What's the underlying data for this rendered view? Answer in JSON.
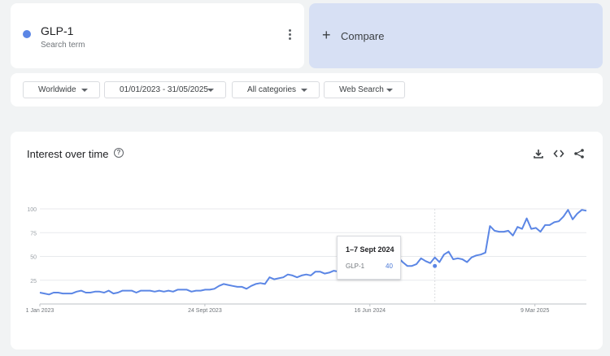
{
  "search_term": {
    "name": "GLP-1",
    "subtitle": "Search term",
    "color": "#5b86e5"
  },
  "compare": {
    "label": "Compare"
  },
  "filters": {
    "region": "Worldwide",
    "date_range": "01/01/2023 - 31/05/2025",
    "category": "All categories",
    "search_type": "Web Search"
  },
  "chart_card": {
    "title": "Interest over time",
    "icons": [
      "help-icon",
      "download-icon",
      "embed-icon",
      "share-icon"
    ]
  },
  "tooltip": {
    "date": "1–7 Sept 2024",
    "term": "GLP-1",
    "value": "40"
  },
  "chart_data": {
    "type": "line",
    "title": "",
    "xlabel": "",
    "ylabel": "",
    "ylim": [
      0,
      100
    ],
    "yticks": [
      25,
      50,
      75,
      100
    ],
    "x_tick_labels": [
      "1 Jan 2023",
      "24 Sept 2023",
      "16 Jun 2024",
      "9 Mar 2025"
    ],
    "x_start": "2023-01-01",
    "x_end": "2025-05-31",
    "grid": true,
    "series": [
      {
        "name": "GLP-1",
        "color": "#5b86e5",
        "values": [
          12,
          11,
          10,
          12,
          12,
          11,
          11,
          11,
          13,
          14,
          12,
          12,
          13,
          13,
          12,
          14,
          11,
          12,
          14,
          14,
          14,
          12,
          14,
          14,
          14,
          13,
          14,
          13,
          14,
          13,
          15,
          15,
          15,
          13,
          14,
          14,
          15,
          15,
          16,
          19,
          21,
          20,
          19,
          18,
          18,
          16,
          19,
          21,
          22,
          21,
          28,
          26,
          27,
          28,
          31,
          30,
          28,
          30,
          31,
          30,
          34,
          34,
          32,
          33,
          35,
          34,
          38,
          38,
          37,
          39,
          40,
          38,
          41,
          42,
          40,
          39,
          40,
          42,
          49,
          44,
          40,
          40,
          42,
          48,
          45,
          43,
          49,
          44,
          52,
          55,
          47,
          48,
          47,
          44,
          49,
          51,
          52,
          54,
          82,
          77,
          76,
          76,
          77,
          72,
          81,
          79,
          90,
          79,
          80,
          76,
          83,
          83,
          86,
          87,
          92,
          99,
          89,
          95,
          99,
          98
        ]
      }
    ],
    "highlight": {
      "date": "1–7 Sept 2024",
      "value": 40
    }
  }
}
